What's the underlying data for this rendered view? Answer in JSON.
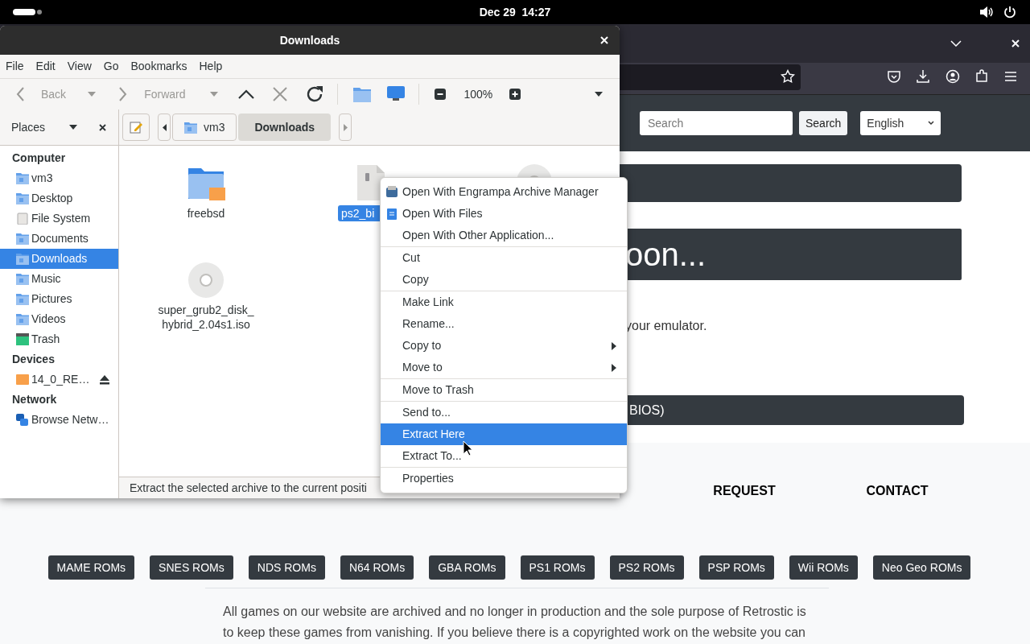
{
  "top_bar": {
    "clock": "Dec 29  14:27"
  },
  "browser": {
    "search": {
      "placeholder": "Search"
    },
    "search_button": "Search",
    "language": "English",
    "heading": "oon...",
    "text": "your emulator.",
    "bar_text": "BIOS)",
    "nav": [
      {
        "label": "REQUEST"
      },
      {
        "label": "CONTACT"
      }
    ],
    "categories": [
      "MAME ROMs",
      "SNES ROMs",
      "NDS ROMs",
      "N64 ROMs",
      "GBA ROMs",
      "PS1 ROMs",
      "PS2 ROMs",
      "PSP ROMs",
      "Wii ROMs",
      "Neo Geo ROMs"
    ],
    "disclaimer": "All games on our website are archived and no longer in production and the sole purpose of Retrostic is to keep these games from vanishing. If you believe there is a copyrighted work on the website you can"
  },
  "files": {
    "title": "Downloads",
    "menu": [
      "File",
      "Edit",
      "View",
      "Go",
      "Bookmarks",
      "Help"
    ],
    "toolbar": [
      {
        "kind": "back",
        "label": "Back",
        "disabled": true
      },
      {
        "kind": "forward",
        "label": "Forward",
        "disabled": true
      },
      {
        "kind": "up",
        "disabled": false
      },
      {
        "kind": "stop",
        "disabled": true
      },
      {
        "kind": "reload",
        "disabled": false
      }
    ],
    "zoom": "100%",
    "places_label": "Places",
    "path": [
      {
        "label": "vm3",
        "selected": false
      },
      {
        "label": "Downloads",
        "selected": true
      }
    ],
    "sidebar": [
      {
        "heading": "Computer",
        "items": [
          {
            "label": "vm3",
            "kind": "folder",
            "selected": false
          },
          {
            "label": "Desktop",
            "kind": "folder",
            "selected": false
          },
          {
            "label": "File System",
            "kind": "drive",
            "selected": false
          },
          {
            "label": "Documents",
            "kind": "folder",
            "selected": false
          },
          {
            "label": "Downloads",
            "kind": "folder",
            "selected": true
          },
          {
            "label": "Music",
            "kind": "folder",
            "selected": false
          },
          {
            "label": "Pictures",
            "kind": "folder",
            "selected": false
          },
          {
            "label": "Videos",
            "kind": "folder",
            "selected": false
          },
          {
            "label": "Trash",
            "kind": "trash",
            "selected": false
          }
        ]
      },
      {
        "heading": "Devices",
        "items": [
          {
            "label": "14_0_RE…",
            "kind": "device",
            "selected": false
          }
        ]
      },
      {
        "heading": "Network",
        "items": [
          {
            "label": "Browse Netw…",
            "kind": "network",
            "selected": false
          }
        ]
      }
    ],
    "items": [
      {
        "name": "freebsd",
        "kind": "folder",
        "selected": false
      },
      {
        "name": "ps2_bi",
        "kind": "archive",
        "selected": true
      },
      {
        "kind": "disc"
      },
      {
        "name": "super_grub2_disk_\nhybrid_2.04s1.iso",
        "kind": "disc",
        "selected": false
      }
    ],
    "status": "Extract the selected archive to the current positi"
  },
  "context_menu": {
    "groups": [
      [
        {
          "label": "Open With Engrampa Archive Manager",
          "kind": "archive",
          "selected": false
        },
        {
          "label": "Open With Files",
          "kind": "files",
          "selected": false
        },
        {
          "label": "Open With Other Application...",
          "selected": false
        }
      ],
      [
        {
          "label": "Cut",
          "selected": false
        },
        {
          "label": "Copy",
          "selected": false
        }
      ],
      [
        {
          "label": "Make Link",
          "selected": false
        },
        {
          "label": "Rename...",
          "selected": false
        },
        {
          "label": "Copy to",
          "submenu": true,
          "selected": false
        },
        {
          "label": "Move to",
          "submenu": true,
          "selected": false
        }
      ],
      [
        {
          "label": "Move to Trash",
          "selected": false
        }
      ],
      [
        {
          "label": "Send to...",
          "selected": false
        },
        {
          "label": "Extract Here",
          "selected": true
        },
        {
          "label": "Extract To...",
          "selected": false
        }
      ],
      [
        {
          "label": "Properties",
          "selected": false
        }
      ]
    ]
  }
}
